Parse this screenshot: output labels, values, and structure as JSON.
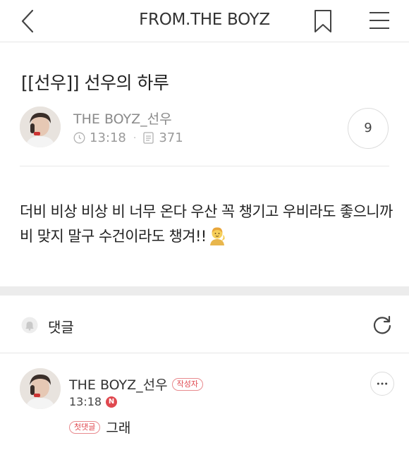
{
  "header": {
    "title": "FROM.THE BOYZ",
    "icons": [
      "back-icon",
      "bookmark-icon",
      "menu-icon"
    ]
  },
  "post": {
    "title": "[[선우]] 선우의 하루",
    "author": "THE BOYZ_선우",
    "time": "13:18",
    "views": "371",
    "comment_count": "9",
    "body": "더비 비상 비상 비 너무 온다 우산 꼭 챙기고 우비라도 좋으니까 비 맞지 말구 수건이라도 챙겨!!"
  },
  "comments_section": {
    "label": "댓글",
    "icons": [
      "bell-icon",
      "refresh-icon"
    ]
  },
  "comments": [
    {
      "author": "THE BOYZ_선우",
      "author_badge": "작성자",
      "time": "13:18",
      "new_badge": "N",
      "reply_badge": "첫댓글",
      "text": "그래"
    }
  ],
  "colors": {
    "accent_red": "#e0484f",
    "divider": "#e6e6e6",
    "band": "#ececec"
  }
}
